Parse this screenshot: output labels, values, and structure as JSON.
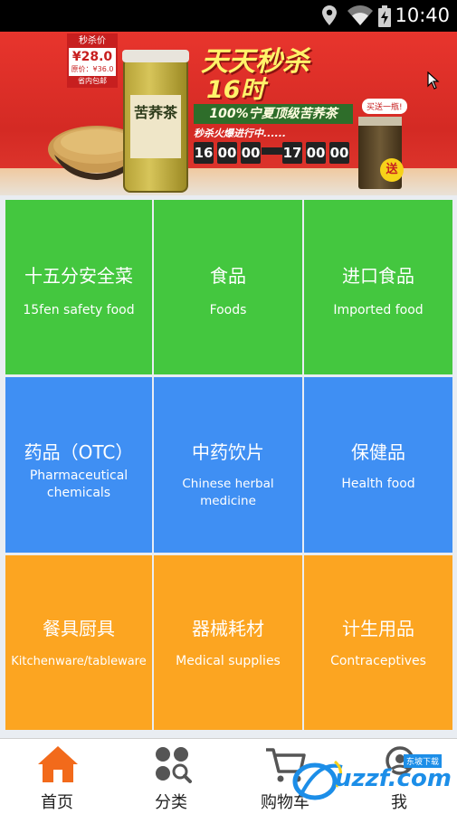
{
  "status_bar": {
    "time": "10:40",
    "icons": [
      "location-icon",
      "wifi-icon",
      "battery-charging-icon"
    ]
  },
  "banner": {
    "price_tag": {
      "head": "秒杀价",
      "price": "¥28.0",
      "original": "原价：¥36.0",
      "foot": "省内包邮"
    },
    "jar_label": "苦荞茶",
    "headline_line1": "天天秒杀",
    "headline_line2": "16时",
    "subtitle": "100%宁夏顶级苦荞茶",
    "promo_text": "秒杀火爆进行中......",
    "countdown": [
      "16",
      "00",
      "00",
      "17",
      "00",
      "00"
    ],
    "gift_ribbon": "买送一瓶!",
    "gift_badge": "送"
  },
  "categories": [
    {
      "zh": "十五分安全菜",
      "en": "15fen safety food",
      "color": "green"
    },
    {
      "zh": "食品",
      "en": "Foods",
      "color": "green"
    },
    {
      "zh": "进口食品",
      "en": "Imported food",
      "color": "green"
    },
    {
      "zh": "药品（OTC）",
      "en": "Pharmaceutical chemicals",
      "en_line1": "Pharmaceutical",
      "en_line2": "chemicals",
      "color": "blue"
    },
    {
      "zh": "中药饮片",
      "en": "Chinese herbal medicine",
      "color": "blue"
    },
    {
      "zh": "保健品",
      "en": "Health food",
      "color": "blue"
    },
    {
      "zh": "餐具厨具",
      "en": "Kitchenware/tableware",
      "color": "orange"
    },
    {
      "zh": "器械耗材",
      "en": "Medical supplies",
      "color": "orange"
    },
    {
      "zh": "计生用品",
      "en": "Contraceptives",
      "color": "orange"
    }
  ],
  "tabbar": {
    "tabs": [
      {
        "label": "首页",
        "icon": "home-icon",
        "active": true
      },
      {
        "label": "分类",
        "icon": "category-search-icon",
        "active": false
      },
      {
        "label": "购物车",
        "icon": "cart-icon",
        "active": false
      },
      {
        "label": "我",
        "icon": "profile-icon",
        "active": false
      }
    ]
  },
  "watermark": {
    "brand": "uzzf.com",
    "tag": "东坡下载"
  },
  "colors": {
    "green": "#44c73f",
    "blue": "#3f8ff3",
    "orange": "#fca521",
    "active_tab": "#f26a1b"
  }
}
